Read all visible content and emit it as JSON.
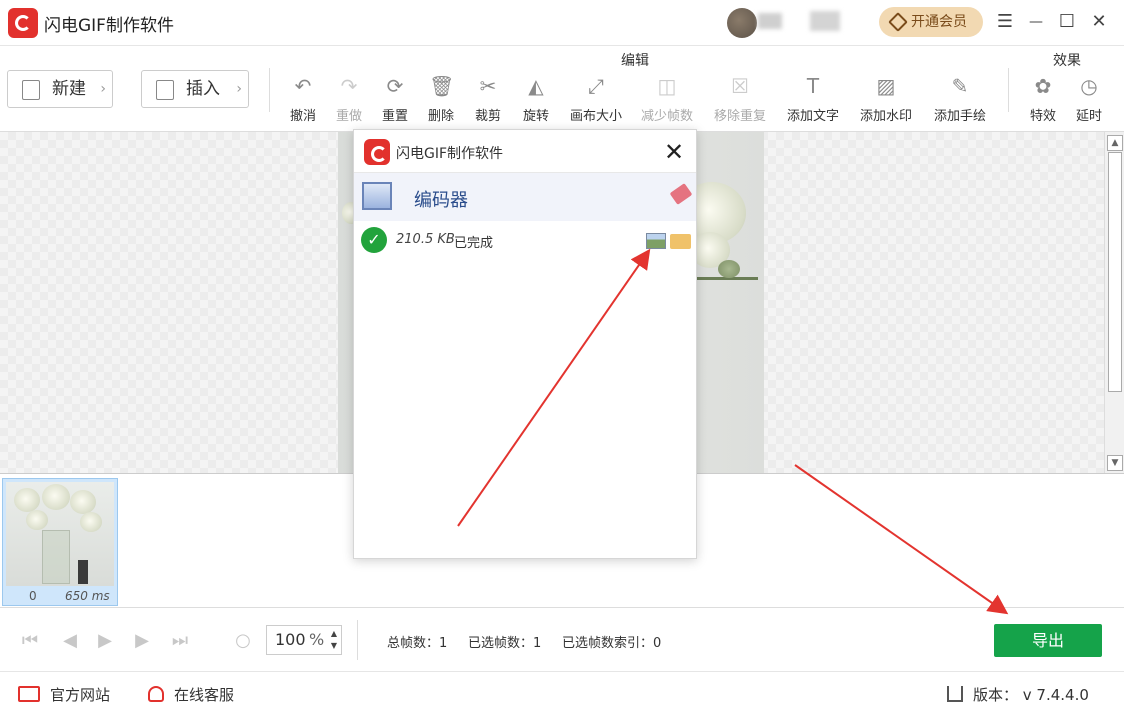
{
  "app": {
    "title": "闪电GIF制作软件",
    "vip_label": "开通会员",
    "brand_color": "#e2312d"
  },
  "window_controls": {
    "menu": "☰",
    "minimize": "—",
    "maximize": "☐",
    "close": "✕"
  },
  "toolbar": {
    "new_label": "新建",
    "insert_label": "插入",
    "edit_group_label": "编辑",
    "effects_group_label": "效果",
    "tools": [
      {
        "label": "撤消",
        "icon": "undo-icon",
        "enabled": true
      },
      {
        "label": "重做",
        "icon": "redo-icon",
        "enabled": false
      },
      {
        "label": "重置",
        "icon": "reset-icon",
        "enabled": true
      },
      {
        "label": "删除",
        "icon": "trash-icon",
        "enabled": true
      },
      {
        "label": "裁剪",
        "icon": "scissors-icon",
        "enabled": true
      },
      {
        "label": "旋转",
        "icon": "rotate-icon",
        "enabled": true
      },
      {
        "label": "画布大小",
        "icon": "canvas-size-icon",
        "enabled": true
      },
      {
        "label": "减少帧数",
        "icon": "reduce-frames-icon",
        "enabled": false
      },
      {
        "label": "移除重复",
        "icon": "remove-duplicate-icon",
        "enabled": false
      },
      {
        "label": "添加文字",
        "icon": "text-icon",
        "enabled": true
      },
      {
        "label": "添加水印",
        "icon": "watermark-icon",
        "enabled": true
      },
      {
        "label": "添加手绘",
        "icon": "pencil-icon",
        "enabled": true
      }
    ],
    "effect_tools": [
      {
        "label": "特效",
        "icon": "effects-icon"
      },
      {
        "label": "延时",
        "icon": "timer-icon"
      }
    ]
  },
  "frames": [
    {
      "index": "0",
      "duration": "650 ms"
    }
  ],
  "controls": {
    "zoom_value": "100",
    "zoom_unit": "%",
    "total_frames": "总帧数：1",
    "selected_frames": "已选帧数：1",
    "selected_index": "已选帧数索引：0",
    "export_label": "导出",
    "export_color": "#15a34a"
  },
  "statusbar": {
    "website": "官方网站",
    "support": "在线客服",
    "version": "版本：  v 7.4.4.0"
  },
  "dialog": {
    "title": "闪电GIF制作软件",
    "section": "编码器",
    "file_size": "210.5 KB",
    "status": "已完成"
  }
}
